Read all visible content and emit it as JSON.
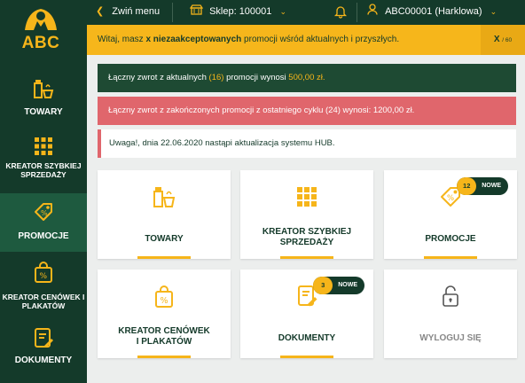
{
  "app": {
    "logo_text": "ABC"
  },
  "sidebar": {
    "items": [
      {
        "label": "TOWARY",
        "icon": "grocery-icon"
      },
      {
        "label": "KREATOR SZYBKIEJ SPRZEDAŻY",
        "icon": "grid-icon"
      },
      {
        "label": "PROMOCJE",
        "icon": "tag-icon"
      },
      {
        "label": "KREATOR CENÓWEK I PLAKATÓW",
        "icon": "percent-bag-icon"
      },
      {
        "label": "DOKUMENTY",
        "icon": "document-icon"
      }
    ]
  },
  "topbar": {
    "collapse_label": "Zwiń menu",
    "store_label": "Sklep: 100001",
    "user_label": "ABC00001 (Harklowa)"
  },
  "banner": {
    "text_prefix": "Witaj, masz ",
    "text_bold": "x niezaakceptowanych",
    "text_suffix": " promocji wśród aktualnych i przyszłych.",
    "counter": "X",
    "counter_total": "/ 60"
  },
  "info": {
    "current_prefix": "Łączny zwrot z aktualnych ",
    "current_count": "(16)",
    "current_middle": " promocji wynosi ",
    "current_amount": "500,00 zł.",
    "finished": "Łączny zwrot z zakończonych promocji z ostatniego cyklu (24) wynosi: 1200,00 zł.",
    "notice": "Uwaga!, dnia 22.06.2020 nastąpi aktualizacja systemu HUB."
  },
  "tiles": [
    {
      "label": "TOWARY"
    },
    {
      "label_line1": "KREATOR SZYBKIEJ",
      "label_line2": "SPRZEDAŻY"
    },
    {
      "label": "PROMOCJE",
      "badge_count": "12",
      "badge_text": "NOWE"
    },
    {
      "label_line1": "KREATOR CENÓWEK",
      "label_line2": "I PLAKATÓW"
    },
    {
      "label": "DOKUMENTY",
      "badge_count": "3",
      "badge_text": "NOWE"
    },
    {
      "label": "WYLOGUJ SIĘ"
    }
  ],
  "colors": {
    "dark_green": "#143a2a",
    "accent_yellow": "#f6b51a",
    "alert_red": "#e0666c",
    "info_green": "#1e4a33"
  }
}
